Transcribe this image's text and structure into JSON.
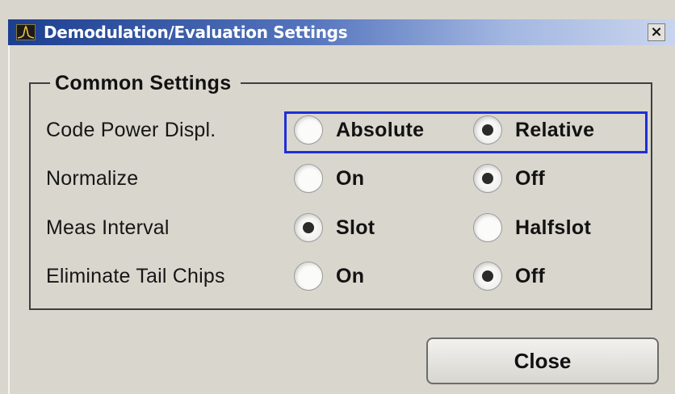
{
  "window": {
    "title": "Demodulation/Evaluation Settings",
    "close_glyph": "×"
  },
  "group": {
    "legend": "Common Settings"
  },
  "rows": [
    {
      "label": "Code Power Displ.",
      "options": [
        "Absolute",
        "Relative"
      ],
      "selected": "Relative"
    },
    {
      "label": "Normalize",
      "options": [
        "On",
        "Off"
      ],
      "selected": "Off"
    },
    {
      "label": "Meas Interval",
      "options": [
        "Slot",
        "Halfslot"
      ],
      "selected": "Slot"
    },
    {
      "label": "Eliminate Tail Chips",
      "options": [
        "On",
        "Off"
      ],
      "selected": "Off"
    }
  ],
  "buttons": {
    "close_label": "Close"
  },
  "colors": {
    "title_gradient_start": "#1c3e8f",
    "title_gradient_end": "#c9d5ee",
    "focus_border": "#1e2fd6",
    "dialog_bg": "#d9d6ce"
  },
  "icons": {
    "app": "spectrum-analyzer-icon",
    "close": "close-icon",
    "radio_checked": "radio-checked-icon",
    "radio_unchecked": "radio-unchecked-icon"
  }
}
